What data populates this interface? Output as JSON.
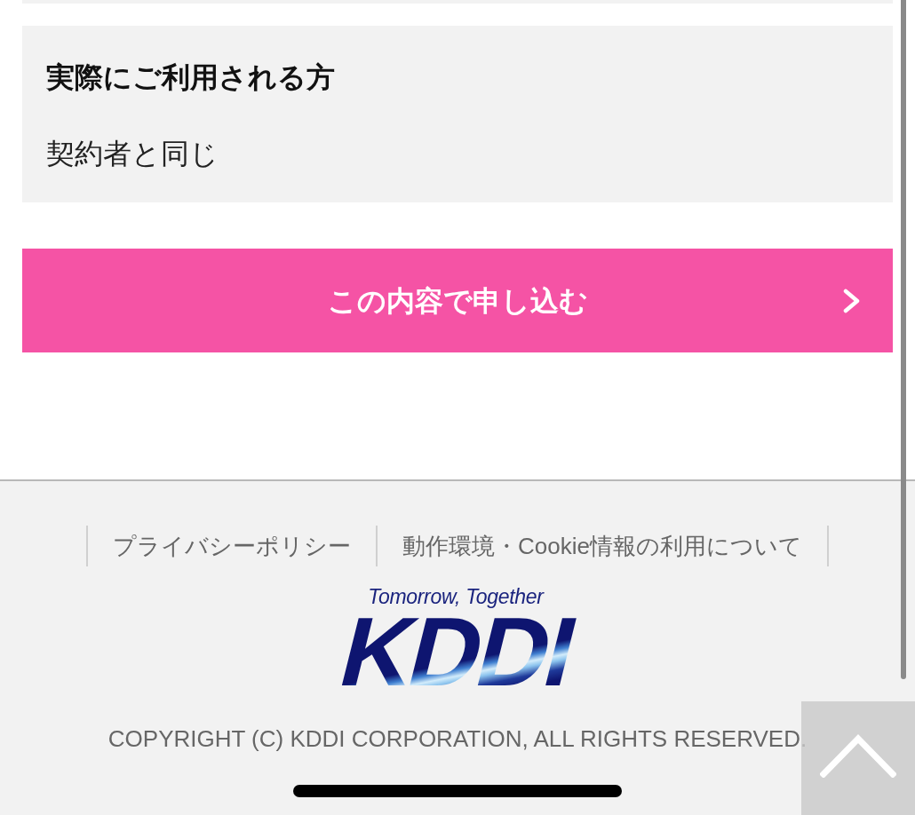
{
  "section": {
    "title": "実際にご利用される方",
    "value": "契約者と同じ"
  },
  "submit_button": {
    "label": "この内容で申し込む"
  },
  "footer": {
    "links": [
      "プライバシーポリシー",
      "動作環境・Cookie情報の利用について"
    ],
    "logo": {
      "tagline": "Tomorrow, Together",
      "wordmark": "KDDI"
    },
    "copyright": "COPYRIGHT (C) KDDI CORPORATION, ALL RIGHTS RESERVED."
  }
}
